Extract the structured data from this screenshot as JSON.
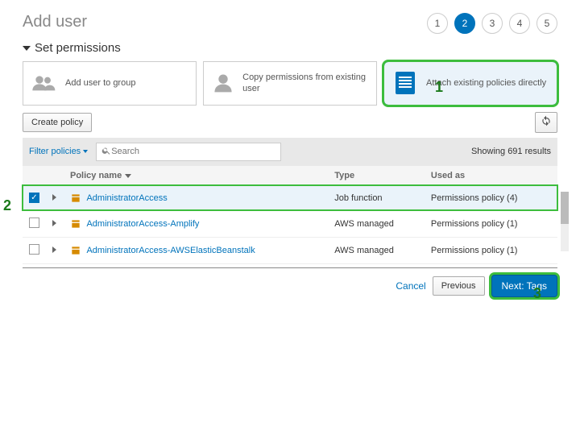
{
  "page": {
    "title": "Add user",
    "section": "Set permissions"
  },
  "stepper": {
    "steps": [
      "1",
      "2",
      "3",
      "4",
      "5"
    ],
    "active_index": 1
  },
  "perm_options": {
    "add_to_group": "Add user to group",
    "copy_existing": "Copy permissions from existing user",
    "attach_direct": "Attach existing policies directly"
  },
  "toolbar": {
    "create_policy": "Create policy",
    "filter_label": "Filter policies",
    "search_placeholder": "Search",
    "results_text": "Showing 691 results"
  },
  "table": {
    "headers": {
      "name": "Policy name",
      "type": "Type",
      "used": "Used as"
    },
    "rows": [
      {
        "checked": true,
        "name": "AdministratorAccess",
        "type": "Job function",
        "used": "Permissions policy (4)"
      },
      {
        "checked": false,
        "name": "AdministratorAccess-Amplify",
        "type": "AWS managed",
        "used": "Permissions policy (1)"
      },
      {
        "checked": false,
        "name": "AdministratorAccess-AWSElasticBeanstalk",
        "type": "AWS managed",
        "used": "Permissions policy (1)"
      }
    ]
  },
  "footer": {
    "cancel": "Cancel",
    "previous": "Previous",
    "next": "Next: Tags"
  },
  "annotations": {
    "one": "1",
    "two": "2",
    "three": "3"
  },
  "colors": {
    "accent": "#0073bb",
    "highlight": "#3dbd3d"
  }
}
